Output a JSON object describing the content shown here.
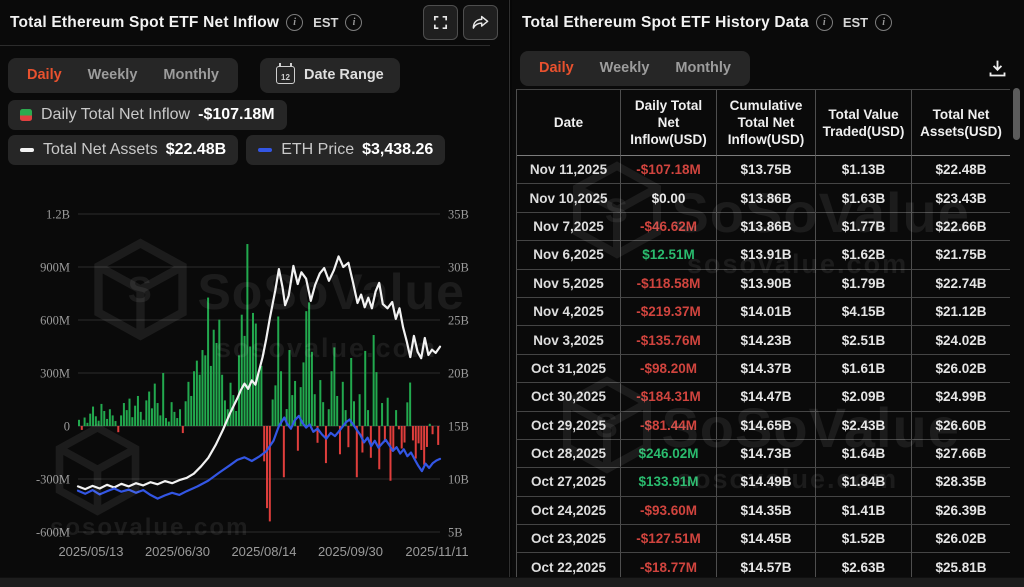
{
  "watermark": {
    "brand": "SoSoValue",
    "domain": "sosovalue.com"
  },
  "colors": {
    "accent": "#e8512e",
    "bar_green": "#22a94e",
    "bar_red": "#e03e3c",
    "line_white": "#f2f2f2",
    "line_blue": "#3356e4",
    "table_neg": "#d0443e",
    "table_pos": "#2abb6e"
  },
  "icons": {
    "info": "info-circle",
    "fullscreen": "expand-corners",
    "share": "curved-arrow",
    "download": "tray-down-arrow",
    "calendar": "calendar-12"
  },
  "left_panel": {
    "title": "Total Ethereum Spot ETF Net Inflow",
    "est_label": "EST",
    "tabs": [
      "Daily",
      "Weekly",
      "Monthly"
    ],
    "active_tab": "Daily",
    "date_range_label": "Date Range",
    "legend": [
      {
        "label": "Daily Total Net Inflow",
        "value": "-$107.18M",
        "marker": "green-red-square"
      },
      {
        "label": "Total Net Assets",
        "value": "$22.48B",
        "marker": "white-dash"
      },
      {
        "label": "ETH Price",
        "value": "$3,438.26",
        "marker": "blue-dash"
      }
    ]
  },
  "right_panel": {
    "title": "Total Ethereum Spot ETF History Data",
    "est_label": "EST",
    "tabs": [
      "Daily",
      "Weekly",
      "Monthly"
    ],
    "active_tab": "Daily",
    "table": {
      "columns": [
        "Date",
        "Daily Total Net Inflow(USD)",
        "Cumulative Total Net Inflow(USD)",
        "Total Value Traded(USD)",
        "Total Net Assets(USD)"
      ],
      "rows": [
        [
          "Nov 11,2025",
          "-$107.18M",
          "$13.75B",
          "$1.13B",
          "$22.48B"
        ],
        [
          "Nov 10,2025",
          "$0.00",
          "$13.86B",
          "$1.63B",
          "$23.43B"
        ],
        [
          "Nov 7,2025",
          "-$46.62M",
          "$13.86B",
          "$1.77B",
          "$22.66B"
        ],
        [
          "Nov 6,2025",
          "$12.51M",
          "$13.91B",
          "$1.62B",
          "$21.75B"
        ],
        [
          "Nov 5,2025",
          "-$118.58M",
          "$13.90B",
          "$1.79B",
          "$22.74B"
        ],
        [
          "Nov 4,2025",
          "-$219.37M",
          "$14.01B",
          "$4.15B",
          "$21.12B"
        ],
        [
          "Nov 3,2025",
          "-$135.76M",
          "$14.23B",
          "$2.51B",
          "$24.02B"
        ],
        [
          "Oct 31,2025",
          "-$98.20M",
          "$14.37B",
          "$1.61B",
          "$26.02B"
        ],
        [
          "Oct 30,2025",
          "-$184.31M",
          "$14.47B",
          "$2.09B",
          "$24.99B"
        ],
        [
          "Oct 29,2025",
          "-$81.44M",
          "$14.65B",
          "$2.43B",
          "$26.60B"
        ],
        [
          "Oct 28,2025",
          "$246.02M",
          "$14.73B",
          "$1.64B",
          "$27.66B"
        ],
        [
          "Oct 27,2025",
          "$133.91M",
          "$14.49B",
          "$1.84B",
          "$28.35B"
        ],
        [
          "Oct 24,2025",
          "-$93.60M",
          "$14.35B",
          "$1.41B",
          "$26.39B"
        ],
        [
          "Oct 23,2025",
          "-$127.51M",
          "$14.45B",
          "$1.52B",
          "$26.02B"
        ],
        [
          "Oct 22,2025",
          "-$18.77M",
          "$14.57B",
          "$2.63B",
          "$25.81B"
        ]
      ]
    }
  },
  "chart_data": {
    "type": "bar",
    "title": "Total Ethereum Spot ETF Net Inflow (Daily)",
    "left_axis": {
      "ticks": [
        "1.2B",
        "900M",
        "600M",
        "300M",
        "0",
        "-300M",
        "-600M"
      ],
      "min": -600,
      "max": 1200,
      "unit": "USD millions"
    },
    "right_axis": {
      "ticks": [
        "35B",
        "30B",
        "25B",
        "20B",
        "15B",
        "10B",
        "5B"
      ],
      "min": 5,
      "max": 35,
      "unit": "USD billions"
    },
    "x_ticks": [
      "2025/05/13",
      "2025/06/30",
      "2025/08/14",
      "2025/09/30",
      "2025/11/11"
    ],
    "grid": true,
    "bars_name": "Daily Total Net Inflow (USD M)",
    "bars": [
      35,
      -22,
      48,
      18,
      70,
      110,
      55,
      30,
      125,
      85,
      40,
      95,
      60,
      28,
      -35,
      60,
      130,
      90,
      155,
      50,
      115,
      170,
      80,
      35,
      145,
      195,
      100,
      240,
      130,
      60,
      300,
      45,
      25,
      135,
      80,
      45,
      95,
      -40,
      140,
      250,
      170,
      310,
      370,
      290,
      430,
      400,
      727,
      340,
      545,
      470,
      602,
      290,
      145,
      95,
      245,
      175,
      85,
      400,
      630,
      510,
      1030,
      450,
      640,
      580,
      300,
      340,
      -200,
      -465,
      -540,
      150,
      230,
      620,
      310,
      -290,
      96,
      430,
      175,
      255,
      -140,
      220,
      360,
      650,
      700,
      420,
      180,
      -95,
      260,
      135,
      -210,
      95,
      310,
      445,
      170,
      -160,
      250,
      90,
      -120,
      385,
      140,
      -290,
      180,
      -150,
      425,
      90,
      -180,
      515,
      305,
      -245,
      130,
      -80,
      160,
      -310,
      -140,
      90,
      -18.77,
      -127.51,
      -93.6,
      133.91,
      246.02,
      -81.44,
      -184.31,
      -98.2,
      -135.76,
      -219.37,
      -118.58,
      12.51,
      -46.62,
      0,
      -107.18
    ],
    "series": [
      {
        "name": "Total Net Assets",
        "unit": "USD billions (right axis)",
        "latest": "$22.48B",
        "points": [
          [
            0,
            9.3
          ],
          [
            0.02,
            9.05
          ],
          [
            0.04,
            9.35
          ],
          [
            0.06,
            9.1
          ],
          [
            0.08,
            9.45
          ],
          [
            0.1,
            9.2
          ],
          [
            0.12,
            9.55
          ],
          [
            0.14,
            9.3
          ],
          [
            0.16,
            9.6
          ],
          [
            0.18,
            9.4
          ],
          [
            0.2,
            9.7
          ],
          [
            0.22,
            9.5
          ],
          [
            0.24,
            9.8
          ],
          [
            0.26,
            9.6
          ],
          [
            0.28,
            9.9
          ],
          [
            0.3,
            10.1
          ],
          [
            0.32,
            10.5
          ],
          [
            0.34,
            11.2
          ],
          [
            0.36,
            12.0
          ],
          [
            0.38,
            13.2
          ],
          [
            0.4,
            14.6
          ],
          [
            0.42,
            16.2
          ],
          [
            0.44,
            17.6
          ],
          [
            0.45,
            18.4
          ],
          [
            0.46,
            19.0
          ],
          [
            0.47,
            18.5
          ],
          [
            0.48,
            19.3
          ],
          [
            0.49,
            18.9
          ],
          [
            0.5,
            20.2
          ],
          [
            0.51,
            21.5
          ],
          [
            0.52,
            23.2
          ],
          [
            0.53,
            25.2
          ],
          [
            0.545,
            27.8
          ],
          [
            0.555,
            29.8
          ],
          [
            0.565,
            28.1
          ],
          [
            0.572,
            26.4
          ],
          [
            0.582,
            27.3
          ],
          [
            0.595,
            30.1
          ],
          [
            0.607,
            28.4
          ],
          [
            0.617,
            29.5
          ],
          [
            0.63,
            28.9
          ],
          [
            0.643,
            26.8
          ],
          [
            0.655,
            28.3
          ],
          [
            0.668,
            29.4
          ],
          [
            0.68,
            29.9
          ],
          [
            0.693,
            28.7
          ],
          [
            0.707,
            29.7
          ],
          [
            0.72,
            31.0
          ],
          [
            0.733,
            30.0
          ],
          [
            0.747,
            30.4
          ],
          [
            0.76,
            28.5
          ],
          [
            0.772,
            26.6
          ],
          [
            0.782,
            27.4
          ],
          [
            0.792,
            26.2
          ],
          [
            0.802,
            27.1
          ],
          [
            0.812,
            26.1
          ],
          [
            0.822,
            27.7
          ],
          [
            0.832,
            28.5
          ],
          [
            0.842,
            26.5
          ],
          [
            0.855,
            26.1
          ],
          [
            0.868,
            26.7
          ],
          [
            0.878,
            25.1
          ],
          [
            0.888,
            26.1
          ],
          [
            0.898,
            24.3
          ],
          [
            0.908,
            23.0
          ],
          [
            0.918,
            21.5
          ],
          [
            0.928,
            23.5
          ],
          [
            0.938,
            22.0
          ],
          [
            0.948,
            21.4
          ],
          [
            0.958,
            23.3
          ],
          [
            0.968,
            21.7
          ],
          [
            0.978,
            22.2
          ],
          [
            0.988,
            21.9
          ],
          [
            1,
            22.48
          ]
        ]
      },
      {
        "name": "ETH Price",
        "unit": "USD (hidden scale), plotted vs right-axis equivalent",
        "latest": "$3,438.26",
        "points": [
          [
            0,
            8.9
          ],
          [
            0.02,
            8.6
          ],
          [
            0.04,
            8.95
          ],
          [
            0.06,
            8.55
          ],
          [
            0.08,
            8.85
          ],
          [
            0.1,
            9.1
          ],
          [
            0.12,
            8.8
          ],
          [
            0.14,
            9.0
          ],
          [
            0.16,
            8.7
          ],
          [
            0.18,
            8.95
          ],
          [
            0.2,
            8.5
          ],
          [
            0.22,
            8.15
          ],
          [
            0.24,
            8.45
          ],
          [
            0.26,
            8.7
          ],
          [
            0.28,
            8.5
          ],
          [
            0.3,
            8.85
          ],
          [
            0.33,
            9.3
          ],
          [
            0.36,
            9.85
          ],
          [
            0.39,
            10.6
          ],
          [
            0.42,
            11.3
          ],
          [
            0.44,
            11.8
          ],
          [
            0.46,
            12.05
          ],
          [
            0.48,
            11.7
          ],
          [
            0.5,
            12.1
          ],
          [
            0.52,
            12.6
          ],
          [
            0.54,
            13.6
          ],
          [
            0.555,
            15.0
          ],
          [
            0.57,
            15.8
          ],
          [
            0.578,
            15.2
          ],
          [
            0.588,
            14.75
          ],
          [
            0.598,
            15.5
          ],
          [
            0.61,
            15.95
          ],
          [
            0.62,
            15.3
          ],
          [
            0.63,
            14.85
          ],
          [
            0.64,
            15.15
          ],
          [
            0.65,
            14.45
          ],
          [
            0.662,
            14.75
          ],
          [
            0.674,
            14.2
          ],
          [
            0.686,
            13.8
          ],
          [
            0.698,
            14.35
          ],
          [
            0.71,
            14.05
          ],
          [
            0.72,
            14.45
          ],
          [
            0.73,
            14.9
          ],
          [
            0.74,
            15.35
          ],
          [
            0.75,
            15.6
          ],
          [
            0.76,
            15.15
          ],
          [
            0.77,
            14.65
          ],
          [
            0.78,
            14.15
          ],
          [
            0.79,
            13.45
          ],
          [
            0.8,
            13.9
          ],
          [
            0.81,
            13.1
          ],
          [
            0.82,
            13.6
          ],
          [
            0.83,
            12.95
          ],
          [
            0.84,
            13.35
          ],
          [
            0.85,
            13.7
          ],
          [
            0.86,
            13.2
          ],
          [
            0.87,
            12.65
          ],
          [
            0.88,
            13.0
          ],
          [
            0.89,
            12.4
          ],
          [
            0.9,
            12.8
          ],
          [
            0.91,
            12.15
          ],
          [
            0.92,
            12.5
          ],
          [
            0.93,
            11.85
          ],
          [
            0.94,
            11.25
          ],
          [
            0.95,
            10.75
          ],
          [
            0.96,
            11.45
          ],
          [
            0.97,
            11.05
          ],
          [
            0.98,
            11.5
          ],
          [
            0.99,
            11.75
          ],
          [
            1,
            11.9
          ]
        ]
      }
    ]
  }
}
